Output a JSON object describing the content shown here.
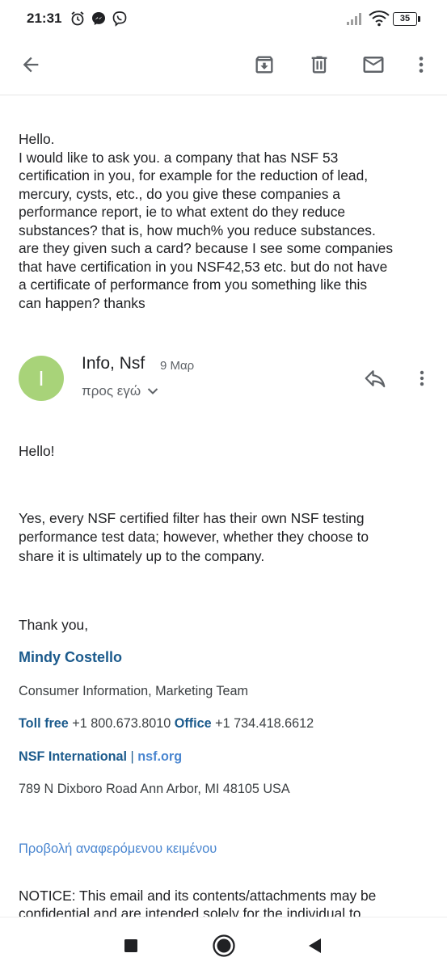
{
  "status_bar": {
    "time": "21:31",
    "battery": "35",
    "icons": [
      "alarm-icon",
      "messenger-icon",
      "viber-icon",
      "signal-icon",
      "wifi-icon",
      "battery-icon"
    ]
  },
  "toolbar": {
    "icons": [
      "back-arrow-icon",
      "archive-icon",
      "delete-icon",
      "mark-unread-icon",
      "more-vert-icon"
    ]
  },
  "quoted_message": {
    "lines": [
      "Hello.",
      "I would like to ask you. a company that has NSF 53",
      "certification in you, for example for the reduction of lead,",
      "mercury, cysts, etc., do you give these companies a",
      "performance report, ie to what extent do they reduce",
      "substances? that is, how much% you reduce substances.",
      "are they given such a card? because I see some companies",
      "that have certification in you NSF42,53 etc. but do not have",
      "a certificate of performance from you something like this",
      "can happen? thanks"
    ]
  },
  "message": {
    "avatar_letter": "I",
    "sender": "Info, Nsf",
    "date": "9 Μαρ",
    "recipient": "προς εγώ",
    "greeting": "Hello!",
    "body_lines": [
      "Yes, every NSF certified filter has their own NSF testing",
      "performance test data; however, whether they choose to",
      "share it is ultimately up to the company."
    ],
    "closing": "Thank you,"
  },
  "signature": {
    "name": "Mindy Costello",
    "title": "Consumer Information, Marketing Team",
    "toll_free_label": "Toll free",
    "toll_free_number": "+1 800.673.8010",
    "office_label": "Office",
    "office_number": "+1 734.418.6612",
    "org_link": "NSF International",
    "separator": "|",
    "site_link": "nsf.org",
    "address": "789 N Dixboro Road Ann Arbor, MI 48105 USA"
  },
  "show_quoted_text": "Προβολή αναφερόμενου κειμένου",
  "notice": {
    "lines": [
      "NOTICE: This email and its contents/attachments may be",
      "confidential and are intended solely for the individual to"
    ]
  },
  "nav_bar": {
    "icons": [
      "recents-square-icon",
      "home-circle-icon",
      "back-triangle-icon"
    ]
  },
  "colors": {
    "avatar": "#a8d379",
    "signature_blue": "#1b5a8c",
    "link_blue": "#4a86d0"
  }
}
